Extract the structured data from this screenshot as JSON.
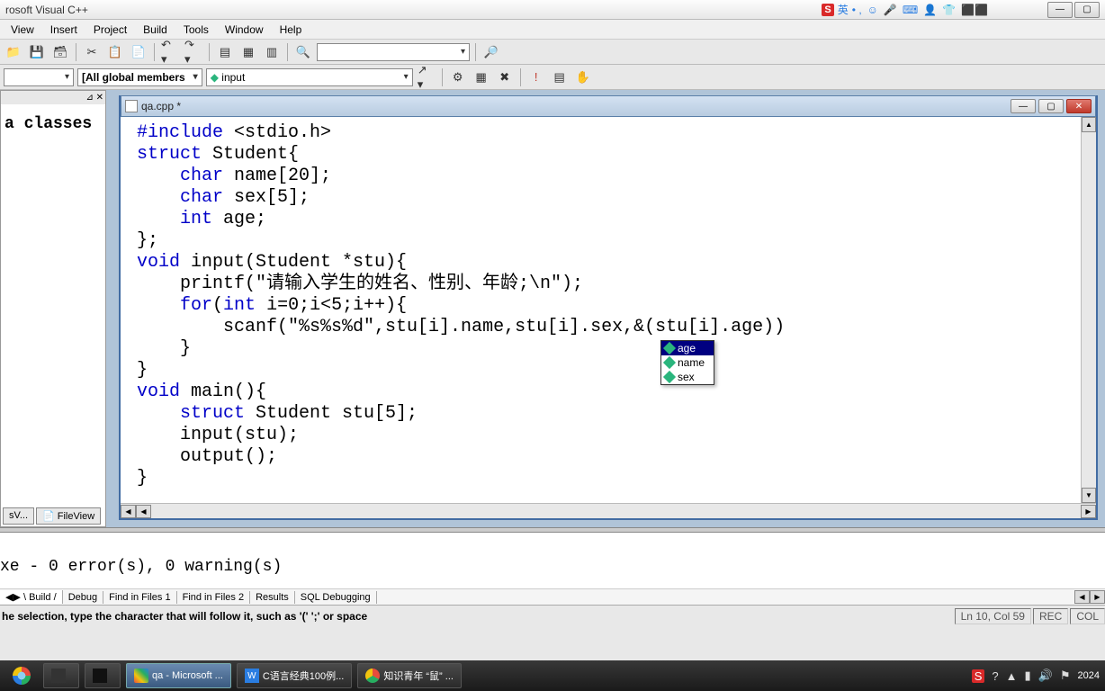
{
  "app": {
    "title": "rosoft Visual C++"
  },
  "ime": {
    "badge": "S",
    "lang": "英",
    "sep": "• ,",
    "icons": [
      "☺",
      "🎤",
      "⌨",
      "👤",
      "👕",
      "⬛⬛"
    ]
  },
  "window_controls": {
    "min": "—",
    "max": "▢",
    "close": "✕"
  },
  "menu": [
    "View",
    "Insert",
    "Project",
    "Build",
    "Tools",
    "Window",
    "Help"
  ],
  "toolbar1": {
    "search_value": ""
  },
  "toolbar2": {
    "class_combo": "",
    "scope_combo": "[All global members",
    "func_combo": "input",
    "diamond": "◆"
  },
  "sidebar": {
    "text": "a classes",
    "tabs": [
      "sV...",
      "FileView"
    ]
  },
  "editor": {
    "title": "qa.cpp *",
    "code_parts": {
      "l1a": "#include",
      "l1b": " <stdio.h>",
      "l2a": "struct",
      "l2b": " Student{",
      "l3a": "    ",
      "l3b": "char",
      "l3c": " name[20];",
      "l4a": "    ",
      "l4b": "char",
      "l4c": " sex[5];",
      "l5a": "    ",
      "l5b": "int",
      "l5c": " age;",
      "l6": "};",
      "l7a": "void",
      "l7b": " input(Student *stu){",
      "l8": "    printf(\"请输入学生的姓名、性别、年龄;\\n\");",
      "l9a": "    ",
      "l9b": "for",
      "l9c": "(",
      "l9d": "int",
      "l9e": " i=0;i<5;i++){",
      "l10": "        scanf(\"%s%s%d\",stu[i].name,stu[i].sex,&(stu[i].age))",
      "l11": "    }",
      "l12": "}",
      "l13a": "void",
      "l13b": " main(){",
      "l14a": "    ",
      "l14b": "struct",
      "l14c": " Student stu[5];",
      "l15": "    input(stu);",
      "l16": "    output();",
      "l17": "}"
    },
    "autocomplete": {
      "items": [
        "age",
        "name",
        "sex"
      ],
      "selected": 0
    }
  },
  "output": {
    "text": "xe - 0 error(s), 0 warning(s)",
    "tabs": [
      "Build",
      "Debug",
      "Find in Files 1",
      "Find in Files 2",
      "Results",
      "SQL Debugging"
    ],
    "active_tab": 0
  },
  "status": {
    "hint": "he selection, type the character that will follow it, such as '(' ';' or space",
    "pos": "Ln 10, Col 59",
    "rec": "REC",
    "col": "COL"
  },
  "taskbar": {
    "items": [
      "",
      "",
      "",
      "qa - Microsoft ...",
      "C语言经典100例...",
      "知识青年 “鼠” ..."
    ],
    "time": "2024",
    "tray_s": "S"
  }
}
